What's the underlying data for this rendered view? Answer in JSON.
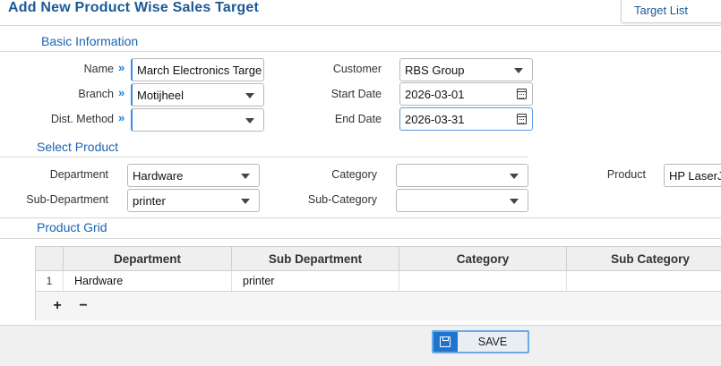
{
  "header": {
    "title": "Add New Product Wise Sales Target",
    "target_list_label": "Target List"
  },
  "basic_info": {
    "section_title": "Basic Information",
    "name_label": "Name",
    "name_value": "March Electronics Targe",
    "branch_label": "Branch",
    "branch_value": "Motijheel",
    "dist_method_label": "Dist. Method",
    "dist_method_value": "",
    "customer_label": "Customer",
    "customer_value": "RBS Group",
    "start_date_label": "Start Date",
    "start_date_value": "2026-03-01",
    "end_date_label": "End Date",
    "end_date_value": "2026-03-31",
    "required_marker": "»"
  },
  "select_product": {
    "section_title": "Select Product",
    "department_label": "Department",
    "department_value": "Hardware",
    "sub_department_label": "Sub-Department",
    "sub_department_value": "printer",
    "category_label": "Category",
    "category_value": "",
    "sub_category_label": "Sub-Category",
    "sub_category_value": "",
    "product_label": "Product",
    "product_value": "HP LaserJe"
  },
  "product_grid": {
    "section_title": "Product Grid",
    "columns": [
      "Department",
      "Sub Department",
      "Category",
      "Sub Category"
    ],
    "rows": [
      {
        "num": "1",
        "department": "Hardware",
        "sub_department": "printer",
        "category": "",
        "sub_category": ""
      }
    ],
    "add_label": "+",
    "remove_label": "−"
  },
  "footer": {
    "save_label": "SAVE",
    "save_icon": "floppy-disk-icon"
  },
  "colors": {
    "title": "#1a5a98",
    "section": "#1a64b4",
    "accent": "#1f74cf",
    "arrow": "#1f7fd6"
  }
}
